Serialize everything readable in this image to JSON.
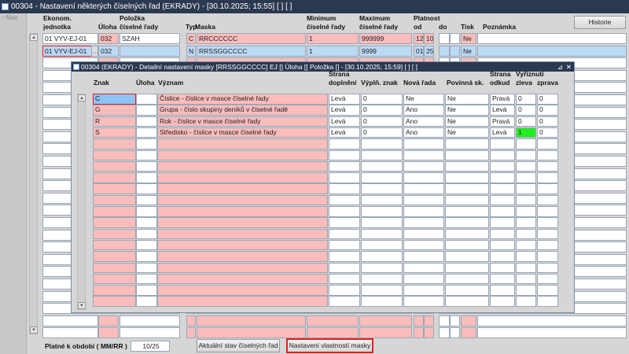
{
  "window": {
    "title": "00304 - Nastavení některých číselných řad (EKRADY) - [30.10.2025; 15:55]  [ ]  [ ]",
    "nav": "Nav",
    "history_button": "Historie"
  },
  "main": {
    "headers": {
      "ekonom": "Ekonom.\njednotka",
      "uloha": "Úloha",
      "polozka": "Položka\nčíselné řady",
      "typ": "Typ",
      "maska": "Maska",
      "minimum": "Minimum\nčíselné řady",
      "maximum": "Maximum\nčíselné řady",
      "platnost": "Platnost",
      "od": "od",
      "do": "do",
      "tisk": "Tisk",
      "poznamka": "Poznámka"
    },
    "rows": [
      {
        "ekonom": "01 VYV-EJ-01",
        "uloha": "032",
        "polozka": "SZAH",
        "typ": "C",
        "maska": "RRCCCCCC",
        "minimum": "1",
        "maximum": "999999",
        "od_mm": "12",
        "od_rr": "10",
        "do_mm": "",
        "do_rr": "",
        "tisk": "Ne",
        "poznamka": ""
      },
      {
        "ekonom": "01 VYV-EJ-01",
        "uloha": "032",
        "polozka": "",
        "typ": "N",
        "maska": "RRSSGGCCCC",
        "minimum": "1",
        "maximum": "9999",
        "od_mm": "01",
        "od_rr": "25",
        "do_mm": "",
        "do_rr": "",
        "tisk": "Ne",
        "poznamka": ""
      }
    ]
  },
  "popup": {
    "title": "00304 (EKRADY) - Detailní nastavení masky [RRSSGGCCCC] EJ [] Úloha [] Položka [] - [30.10.2025; 15:59]  [ ]  [ ]",
    "headers": {
      "znak": "Znak",
      "uloha": "Úloha",
      "vyznam": "Význam",
      "strana_dopl": "Strana\ndoplnění",
      "vypln": "Výplň. znak",
      "nova_rada": "Nová řada",
      "povinna": "Povinná sk.",
      "strana_odkud": "Strana\nodkud",
      "vyriznuti": "Vyříznutí",
      "zleva": "zleva",
      "zprava": "zprava"
    },
    "rows": [
      {
        "znak": "C",
        "uloha": "",
        "vyznam": "Číslice - číslice v masce číselné řady",
        "strana_dopl": "Levá",
        "vypln": "0",
        "nova_rada": "Ne",
        "povinna": "Ne",
        "strana_odkud": "Pravá",
        "zleva": "0",
        "zprava": "0"
      },
      {
        "znak": "G",
        "uloha": "",
        "vyznam": "Grupa - číslo skupiny deníků v číselné řadě",
        "strana_dopl": "Levá",
        "vypln": "0",
        "nova_rada": "Ano",
        "povinna": "Ne",
        "strana_odkud": "Levá",
        "zleva": "0",
        "zprava": "0"
      },
      {
        "znak": "R",
        "uloha": "",
        "vyznam": "Rok - číslice v masce číselné řady",
        "strana_dopl": "Levá",
        "vypln": "0",
        "nova_rada": "Ano",
        "povinna": "Ne",
        "strana_odkud": "Pravá",
        "zleva": "0",
        "zprava": "0"
      },
      {
        "znak": "S",
        "uloha": "",
        "vyznam": "Středisko - číslice v masce číselné řady",
        "strana_dopl": "Levá",
        "vypln": "0",
        "nova_rada": "Ano",
        "povinna": "Ne",
        "strana_odkud": "Levá",
        "zleva": "1",
        "zprava": "0"
      }
    ]
  },
  "footer": {
    "period_label": "Platné k období ( MM/RR )",
    "period_value": "10/25",
    "current_state_button": "Aktuální stav číselných řad",
    "mask_settings_button": "Nastavení vlastností masky"
  },
  "colors": {
    "titlebar": "#2b3950",
    "required": "#fbbcbc",
    "selected_row": "#bcd9f5",
    "highlight": "#22ee22",
    "focus_border": "#e02020"
  }
}
